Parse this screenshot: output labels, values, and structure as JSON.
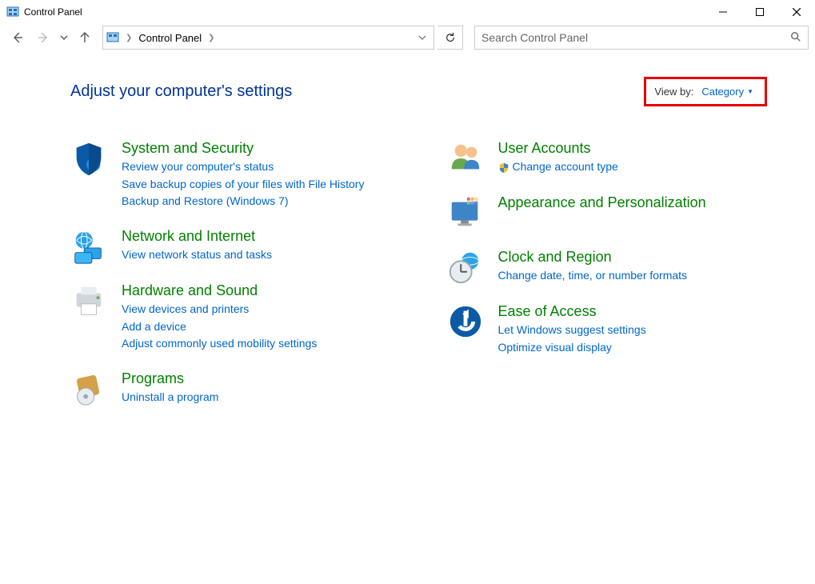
{
  "window": {
    "title": "Control Panel"
  },
  "addressbar": {
    "crumb1": "Control Panel"
  },
  "search": {
    "placeholder": "Search Control Panel"
  },
  "header": {
    "title": "Adjust your computer's settings",
    "viewby_label": "View by:",
    "viewby_value": "Category"
  },
  "categories": {
    "left": [
      {
        "title": "System and Security",
        "links": [
          "Review your computer's status",
          "Save backup copies of your files with File History",
          "Backup and Restore (Windows 7)"
        ]
      },
      {
        "title": "Network and Internet",
        "links": [
          "View network status and tasks"
        ]
      },
      {
        "title": "Hardware and Sound",
        "links": [
          "View devices and printers",
          "Add a device",
          "Adjust commonly used mobility settings"
        ]
      },
      {
        "title": "Programs",
        "links": [
          "Uninstall a program"
        ]
      }
    ],
    "right": [
      {
        "title": "User Accounts",
        "links": [
          "Change account type"
        ],
        "shield": true
      },
      {
        "title": "Appearance and Personalization",
        "links": []
      },
      {
        "title": "Clock and Region",
        "links": [
          "Change date, time, or number formats"
        ]
      },
      {
        "title": "Ease of Access",
        "links": [
          "Let Windows suggest settings",
          "Optimize visual display"
        ]
      }
    ]
  }
}
